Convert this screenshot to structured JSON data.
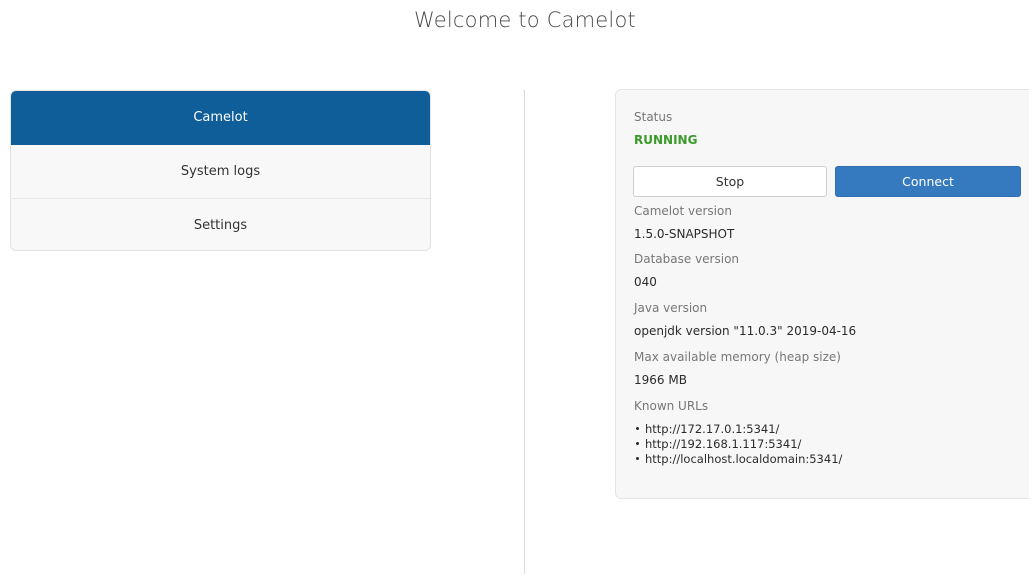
{
  "header": {
    "title": "Welcome to Camelot"
  },
  "nav": {
    "items": [
      {
        "label": "Camelot",
        "active": true
      },
      {
        "label": "System logs",
        "active": false
      },
      {
        "label": "Settings",
        "active": false
      }
    ]
  },
  "status": {
    "status_label": "Status",
    "status_value": "RUNNING",
    "stop_label": "Stop",
    "connect_label": "Connect",
    "camelot_version_label": "Camelot version",
    "camelot_version_value": "1.5.0-SNAPSHOT",
    "database_version_label": "Database version",
    "database_version_value": "040",
    "java_version_label": "Java version",
    "java_version_value": "openjdk version \"11.0.3\" 2019-04-16",
    "memory_label": "Max available memory (heap size)",
    "memory_value": "1966 MB",
    "urls_label": "Known URLs",
    "urls": [
      "http://172.17.0.1:5341/",
      "http://192.168.1.117:5341/",
      "http://localhost.localdomain:5341/"
    ]
  },
  "colors": {
    "active_nav": "#0f5e99",
    "connect_button": "#3579bf",
    "running_status": "#3a9a2a"
  }
}
